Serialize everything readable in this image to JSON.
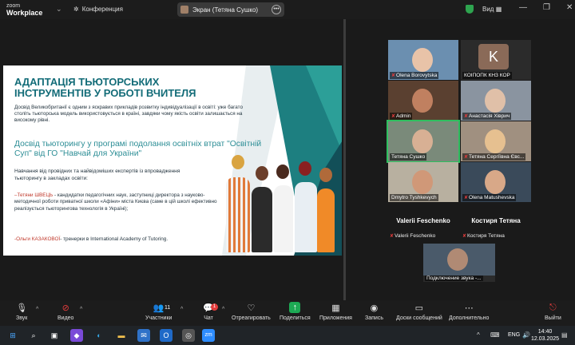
{
  "titlebar": {
    "logo_top": "zoom",
    "logo_bottom": "Workplace",
    "conference": "Конференция",
    "screen_pill": "Экран (Тетяна Сушко)",
    "view_label": "Вид",
    "menu_dots": "•••"
  },
  "slide": {
    "title": "АДАПТАЦІЯ ТЬЮТОРСЬКИХ ІНСТРУМЕНТІВ У РОБОТІ ВЧИТЕЛЯ",
    "intro": "Досвід Великобританії є одним з яскравих прикладів розвитку індивідуалізації в освіті: уже багато століть тьюторська модель використовується в країні, завдяки чому якість освіти залишається на високому рівні.",
    "subtitle": "Досвід тьюторингу у програмі подолання освітніх втрат \"Освітній Суп\" від ГО \"Навчай для України\"",
    "learn": "Навчання від провідних та найвідоміших експертів із впровадження тьюторингу в закладах освіти:",
    "expert1_name": "–Тетяни ШВЕЦЬ",
    "expert1_text": " - кандидатки педагогічних наук, заступниці директора з науково-методичної роботи приватної школи «Афіни» міста Києва (саме в цій школі ефективно реалізується тьюторингова технологія в Україні);",
    "expert2_name": "-Ольги КАЗАКОВОЇ",
    "expert2_text": "- тренерки в International Academy of Tutoring."
  },
  "participants": [
    {
      "name": "Olena Borovytska",
      "muted": true
    },
    {
      "name": "КОІПОПК КНЗ КОР",
      "muted": false,
      "initial": "K"
    },
    {
      "name": "Admin",
      "muted": true
    },
    {
      "name": "Анастасія Хіврич",
      "muted": true
    },
    {
      "name": "Тетяна Сушко",
      "muted": false,
      "active": true
    },
    {
      "name": "Тетяна Сергіївна Євс...",
      "muted": true
    },
    {
      "name": "Dmytro Tyshkevych",
      "muted": false
    },
    {
      "name": "Olena Matushevska",
      "muted": true
    }
  ],
  "audio_only": [
    {
      "big": "Valerii Feschenko",
      "small": "Valerii Feschenko"
    },
    {
      "big": "Костиря Тетяна",
      "small": "Костиря Тетяна"
    }
  ],
  "extra_tile": {
    "name": "Подключение звука -..."
  },
  "toolbar": {
    "audio": "Звук",
    "video": "Видео",
    "participants": "Участники",
    "participants_count": "11",
    "chat": "Чат",
    "chat_badge": "1",
    "react": "Отреагировать",
    "share": "Поделиться",
    "apps": "Приложения",
    "record": "Запись",
    "whiteboards": "Доски сообщений",
    "more": "Дополнительно",
    "leave": "Выйти"
  },
  "taskbar": {
    "lang": "ENG",
    "time": "14:40",
    "date": "12.03.2025",
    "zoom_label": "zm"
  },
  "colors": {
    "teal": "#136c78",
    "accent_green": "#1da954",
    "mute_red": "#e23c3c"
  }
}
